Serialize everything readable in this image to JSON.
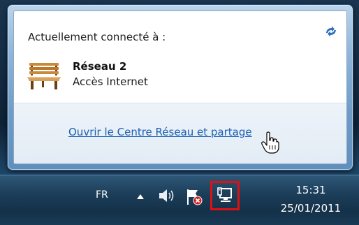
{
  "flyout": {
    "connected_label": "Actuellement connecté à :",
    "network_name": "Réseau  2",
    "network_status": "Accès Internet",
    "open_center_link": "Ouvrir le Centre Réseau et partage",
    "refresh_icon": "refresh-icon",
    "network_icon": "bench-network-icon"
  },
  "taskbar": {
    "language": "FR",
    "time": "15:31",
    "date": "25/01/2011",
    "icons": [
      "show-hidden-icons-arrow",
      "volume-icon",
      "action-center-flag-icon",
      "network-icon"
    ],
    "highlight_color": "#e01010"
  },
  "cursor": "hand-pointer"
}
